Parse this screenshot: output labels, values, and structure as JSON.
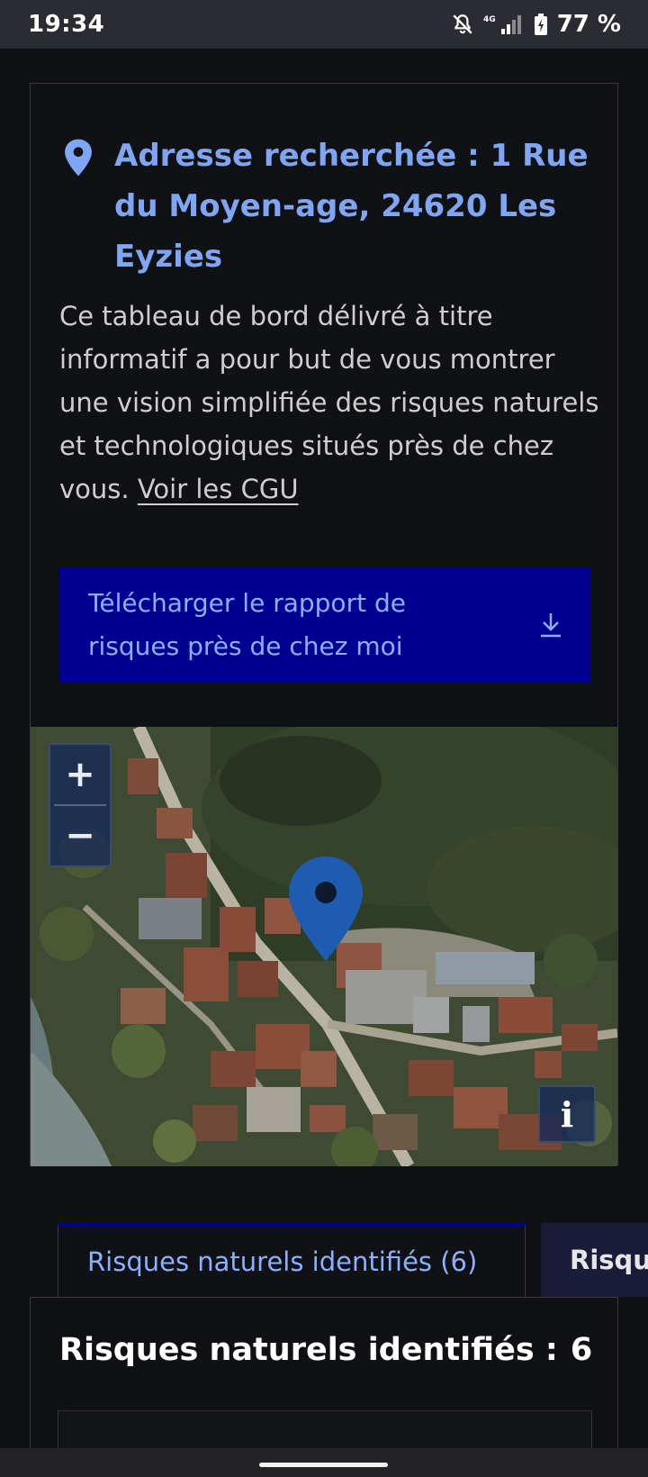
{
  "status_bar": {
    "time": "19:34",
    "network": "4G",
    "battery": "77 %"
  },
  "address": {
    "title": "Adresse recherchée : 1 Rue du Moyen-age, 24620 Les Eyzies"
  },
  "description": {
    "text": "Ce tableau de bord délivré à titre informatif a pour but de vous montrer une vision simplifiée des risques naturels et technologiques situés près de chez vous. ",
    "link": "Voir les CGU"
  },
  "download_button": {
    "label": "Télécharger le rapport de risques près de chez moi"
  },
  "map": {
    "zoom_in": "+",
    "zoom_out": "−",
    "info": "i"
  },
  "tabs": [
    {
      "label": "Risques naturels identifiés (6)",
      "active": true
    },
    {
      "label": "Risques technologiques",
      "active": false
    }
  ],
  "panel": {
    "title": "Risques naturels identifiés :",
    "count": "6"
  },
  "colors": {
    "accent_text": "#8ab0ff",
    "primary_blue": "#000091",
    "background": "#101114",
    "marker": "#1d5cb0"
  }
}
